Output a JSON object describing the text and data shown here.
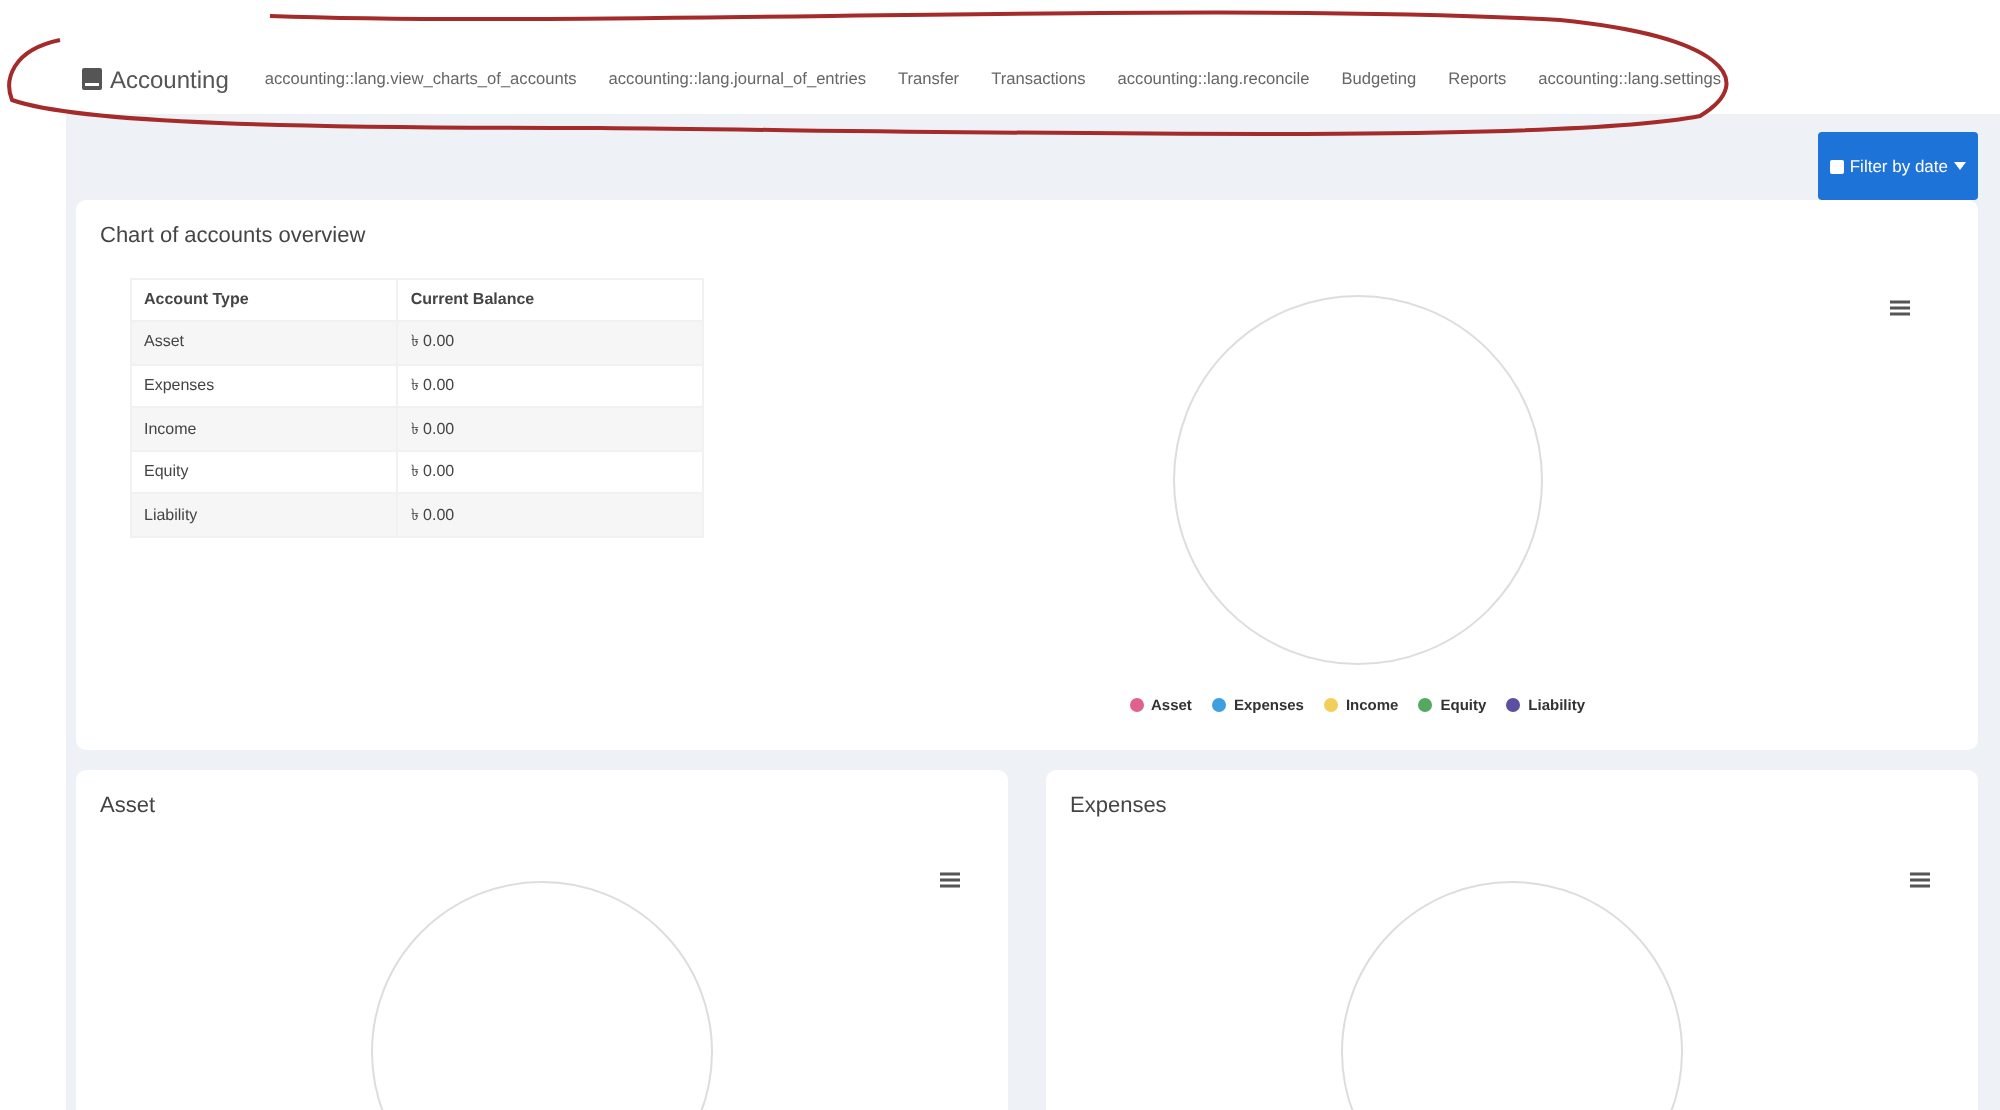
{
  "navbar": {
    "brand": "Accounting",
    "items": [
      {
        "label": "accounting::lang.view_charts_of_accounts"
      },
      {
        "label": "accounting::lang.journal_of_entries"
      },
      {
        "label": "Transfer"
      },
      {
        "label": "Transactions"
      },
      {
        "label": "accounting::lang.reconcile"
      },
      {
        "label": "Budgeting"
      },
      {
        "label": "Reports"
      },
      {
        "label": "accounting::lang.settings"
      }
    ]
  },
  "filter_button": {
    "label": "Filter by date"
  },
  "overview": {
    "title": "Chart of accounts overview",
    "table": {
      "columns": [
        "Account Type",
        "Current Balance"
      ],
      "rows": [
        [
          "Asset",
          "৳ 0.00"
        ],
        [
          "Expenses",
          "৳ 0.00"
        ],
        [
          "Income",
          "৳ 0.00"
        ],
        [
          "Equity",
          "৳ 0.00"
        ],
        [
          "Liability",
          "৳ 0.00"
        ]
      ]
    },
    "legend": [
      {
        "label": "Asset",
        "color": "#e0628a"
      },
      {
        "label": "Expenses",
        "color": "#3d9fe0"
      },
      {
        "label": "Income",
        "color": "#f2cf5b"
      },
      {
        "label": "Equity",
        "color": "#55a860"
      },
      {
        "label": "Liability",
        "color": "#5a4fa0"
      }
    ]
  },
  "cards": [
    {
      "title": "Asset"
    },
    {
      "title": "Expenses"
    }
  ]
}
